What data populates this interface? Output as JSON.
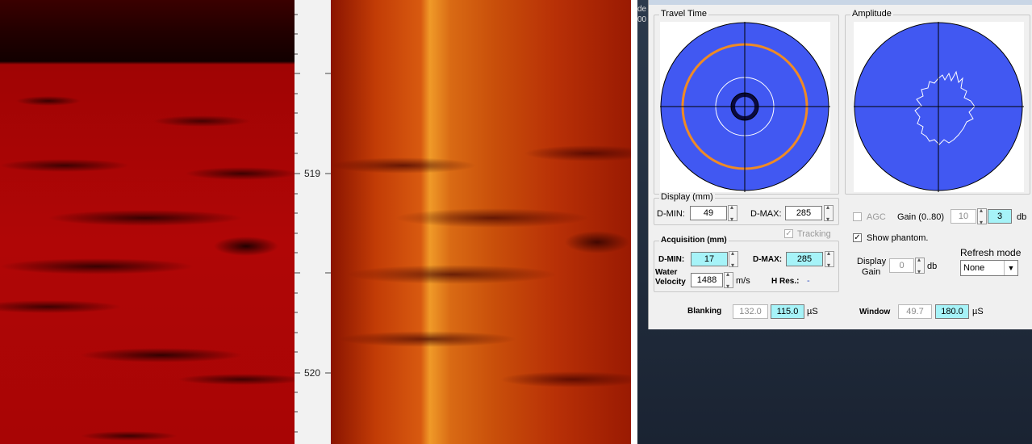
{
  "depth_scale": {
    "labels": [
      "519",
      "520"
    ]
  },
  "desktop": {
    "text_top": "de",
    "text_second": "00"
  },
  "dialog": {
    "travel_time": {
      "title": "Travel Time"
    },
    "amplitude": {
      "title": "Amplitude"
    },
    "display": {
      "title": "Display (mm)",
      "dmin_label": "D-MIN:",
      "dmin_value": "49",
      "dmax_label": "D-MAX:",
      "dmax_value": "285"
    },
    "tracking": {
      "label": "Tracking",
      "checked": true
    },
    "acquisition": {
      "title": "Acquisition (mm)",
      "dmin_label": "D-MIN:",
      "dmin_value": "17",
      "dmax_label": "D-MAX:",
      "dmax_value": "285",
      "water_velocity_label_1": "Water",
      "water_velocity_label_2": "Velocity",
      "water_velocity_value": "1488",
      "water_velocity_unit": "m/s",
      "hres_label": "H Res.:",
      "hres_value": "-"
    },
    "gain": {
      "agc_label": "AGC",
      "gain_label": "Gain (0..80)",
      "gain_value_disabled": "10",
      "gain_value": "3",
      "gain_unit": "db"
    },
    "show_phantom": {
      "label": "Show phantom.",
      "checked": true
    },
    "display_gain": {
      "label_1": "Display",
      "label_2": "Gain",
      "value": "0",
      "unit": "db"
    },
    "refresh_mode": {
      "label": "Refresh mode",
      "value": "None"
    },
    "blanking": {
      "label": "Blanking",
      "value_1": "132.0",
      "value_2": "115.0",
      "unit": "µS"
    },
    "window": {
      "label": "Window",
      "value_1": "49.7",
      "value_2": "180.0",
      "unit": "µS"
    }
  },
  "colors": {
    "radar_blue": "#4158f2",
    "ring_orange": "#ef8a25",
    "field_cyan": "#a6f3f8"
  }
}
